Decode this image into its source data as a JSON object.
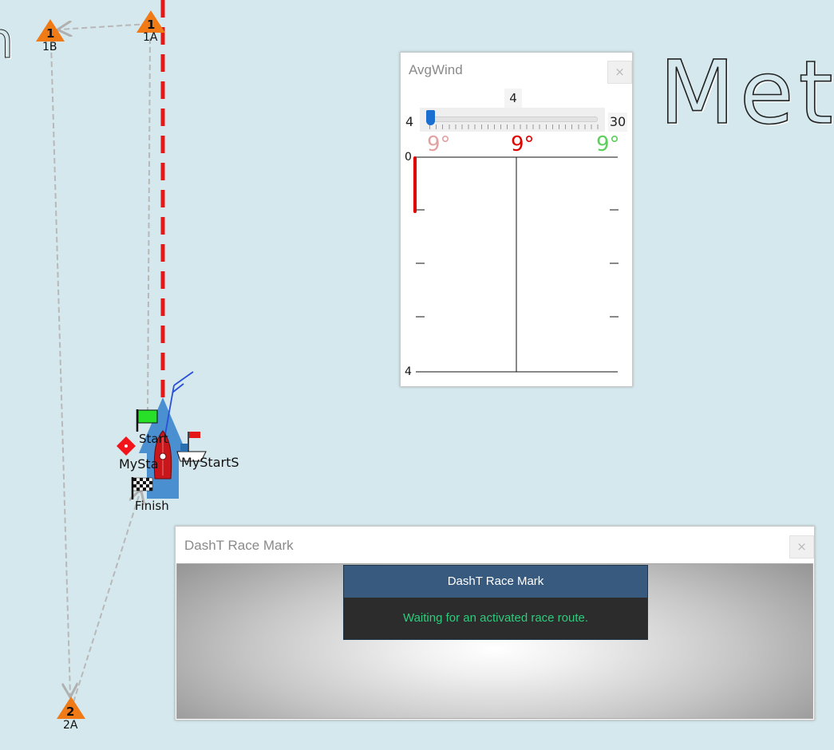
{
  "map": {
    "watermark_left": "n",
    "watermark_right": "Met",
    "marks": {
      "m1b_num": "1",
      "m1b_label": "1B",
      "m1a_num": "1",
      "m1a_label": "1A",
      "m2a_num": "2",
      "m2a_label": "2A"
    },
    "start_label": "Start",
    "mystart_port_label": "MyStartP",
    "mystart_stbd_label": "MyStartS",
    "finish_label": "Finish",
    "colors": {
      "mark": "#f07a16",
      "start_line": "#e51818",
      "boat": "#c8161a",
      "start_area": "#4a8fd0",
      "route": "#b8b8b8"
    }
  },
  "avgwind": {
    "title": "AvgWind",
    "close": "×",
    "slider": {
      "value": "4",
      "min": "4",
      "max": "30"
    },
    "deg_left": "9°",
    "deg_center": "9°",
    "deg_right": "9°",
    "axis_top": "0",
    "axis_bottom": "4"
  },
  "race_mark": {
    "title": "DashT Race Mark",
    "close": "×",
    "card_header": "DashT Race Mark",
    "card_message": "Waiting for an activated race route."
  }
}
